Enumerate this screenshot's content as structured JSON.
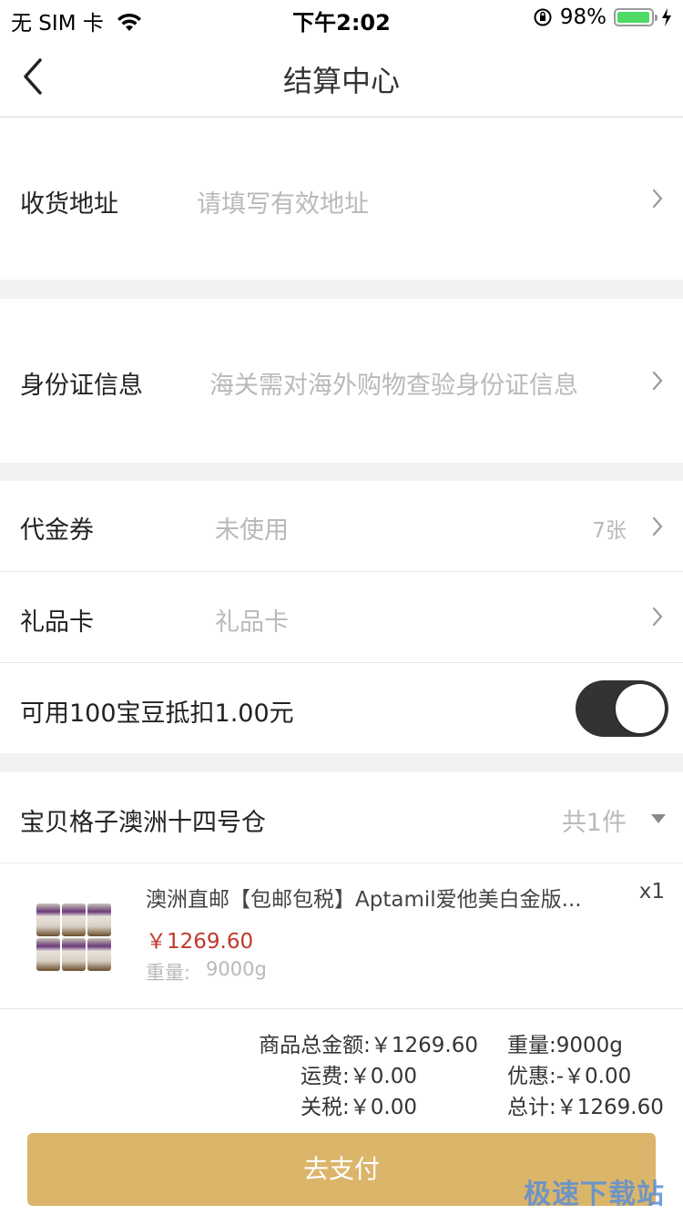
{
  "status_bar": {
    "carrier": "无 SIM 卡",
    "time": "下午2:02",
    "battery": "98%",
    "battery_level": 0.98
  },
  "nav": {
    "title": "结算中心"
  },
  "address": {
    "label": "收货地址",
    "placeholder": "请填写有效地址"
  },
  "id_info": {
    "label": "身份证信息",
    "placeholder": "海关需对海外购物查验身份证信息"
  },
  "coupon": {
    "label": "代金券",
    "value": "未使用",
    "count": "7张"
  },
  "gift_card": {
    "label": "礼品卡",
    "value": "礼品卡"
  },
  "beans": {
    "label": "可用100宝豆抵扣1.00元",
    "enabled": true
  },
  "warehouse": {
    "name": "宝贝格子澳洲十四号仓",
    "count": "共1件"
  },
  "product": {
    "title": "澳洲直邮【包邮包税】Aptamil爱他美白金版...",
    "price": "￥1269.60",
    "weight_label": "重量:",
    "weight_value": "9000g",
    "qty": "x1"
  },
  "summary": {
    "goods_total": "商品总金额:￥1269.60",
    "weight": "重量:9000g",
    "shipping": "运费:￥0.00",
    "discount": "优惠:-￥0.00",
    "tax": "关税:￥0.00",
    "total": "总计:￥1269.60"
  },
  "pay_button": "去支付",
  "watermark": "极速下载站",
  "colors": {
    "accent": "#dbb56a",
    "price": "#c0392b",
    "toggle_on": "#333333"
  }
}
